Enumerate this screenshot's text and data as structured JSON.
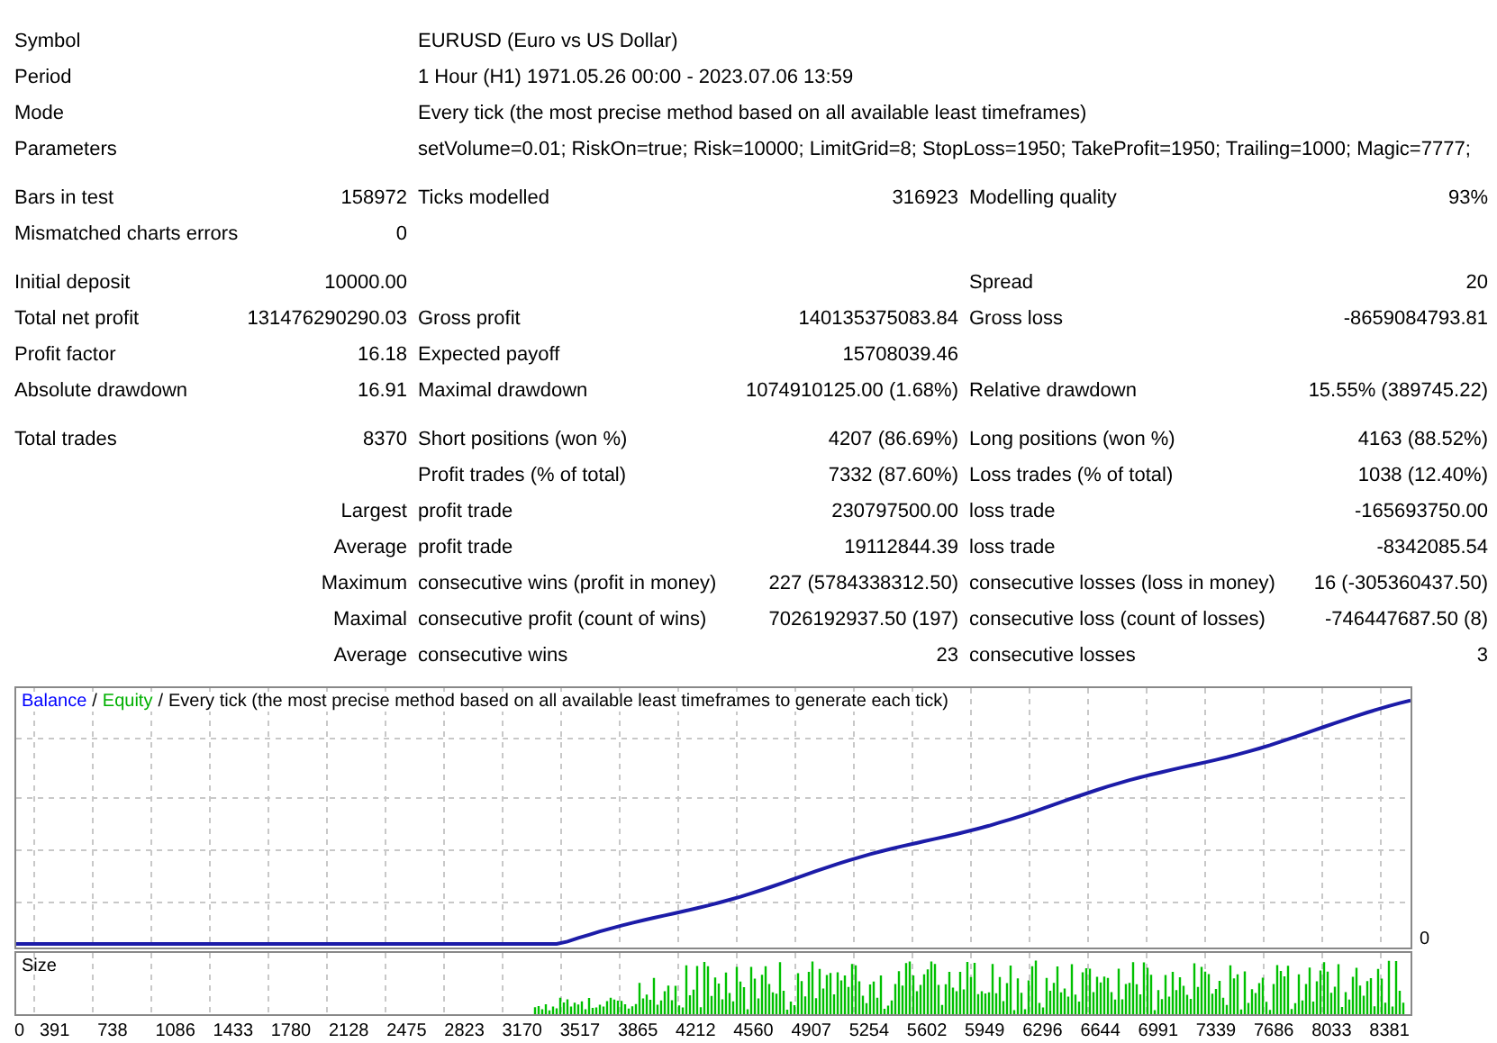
{
  "header": [
    {
      "label": "Symbol",
      "value": "EURUSD (Euro vs US Dollar)"
    },
    {
      "label": "Period",
      "value": "1 Hour (H1) 1971.05.26 00:00 - 2023.07.06 13:59"
    },
    {
      "label": "Mode",
      "value": "Every tick (the most precise method based on all available least timeframes)"
    },
    {
      "label": "Parameters",
      "value": "setVolume=0.01; RiskOn=true; Risk=10000; LimitGrid=8; StopLoss=1950; TakeProfit=1950; Trailing=1000; Magic=7777;"
    }
  ],
  "sections": [
    [
      {
        "cells": [
          {
            "label": "Bars in test",
            "value": "158972"
          },
          {
            "label": "Ticks modelled",
            "value": "316923"
          },
          {
            "label": "Modelling quality",
            "value": "93%"
          }
        ]
      },
      {
        "cells": [
          {
            "label": "Mismatched charts errors",
            "value": "0"
          }
        ]
      }
    ],
    [
      {
        "cells": [
          {
            "label": "Initial deposit",
            "value": "10000.00"
          },
          null,
          {
            "label": "Spread",
            "value": "20"
          }
        ]
      },
      {
        "cells": [
          {
            "label": "Total net profit",
            "value": "131476290290.03"
          },
          {
            "label": "Gross profit",
            "value": "140135375083.84"
          },
          {
            "label": "Gross loss",
            "value": "-8659084793.81"
          }
        ]
      },
      {
        "cells": [
          {
            "label": "Profit factor",
            "value": "16.18"
          },
          {
            "label": "Expected payoff",
            "value": "15708039.46"
          }
        ]
      },
      {
        "cells": [
          {
            "label": "Absolute drawdown",
            "value": "16.91"
          },
          {
            "label": "Maximal drawdown",
            "value": "1074910125.00 (1.68%)"
          },
          {
            "label": "Relative drawdown",
            "value": "15.55% (389745.22)"
          }
        ]
      }
    ],
    [
      {
        "cells": [
          {
            "label": "Total trades",
            "value": "8370"
          },
          {
            "label": "Short positions (won %)",
            "value": "4207 (86.69%)"
          },
          {
            "label": "Long positions (won %)",
            "value": "4163 (88.52%)"
          }
        ]
      },
      {
        "cells": [
          null,
          {
            "label": "Profit trades (% of total)",
            "value": "7332 (87.60%)"
          },
          {
            "label": "Loss trades (% of total)",
            "value": "1038 (12.40%)"
          }
        ]
      },
      {
        "prefix": "Largest",
        "cells": [
          null,
          {
            "label": "profit trade",
            "value": "230797500.00"
          },
          {
            "label": "loss trade",
            "value": "-165693750.00"
          }
        ]
      },
      {
        "prefix": "Average",
        "cells": [
          null,
          {
            "label": "profit trade",
            "value": "19112844.39"
          },
          {
            "label": "loss trade",
            "value": "-8342085.54"
          }
        ]
      },
      {
        "prefix": "Maximum",
        "cells": [
          null,
          {
            "label": "consecutive wins (profit in money)",
            "value": "227 (5784338312.50)"
          },
          {
            "label": "consecutive losses (loss in money)",
            "value": "16 (-305360437.50)"
          }
        ]
      },
      {
        "prefix": "Maximal",
        "cells": [
          null,
          {
            "label": "consecutive profit (count of wins)",
            "value": "7026192937.50 (197)"
          },
          {
            "label": "consecutive loss (count of losses)",
            "value": "-746447687.50 (8)"
          }
        ]
      },
      {
        "prefix": "Average",
        "cells": [
          null,
          {
            "label": "consecutive wins",
            "value": "23"
          },
          {
            "label": "consecutive losses",
            "value": "3"
          }
        ]
      }
    ]
  ],
  "chart": {
    "legend": [
      {
        "label": "Balance",
        "color": "#0000ff"
      },
      {
        "label": "Equity",
        "color": "#00b000"
      },
      {
        "label": "Every tick (the most precise method based on all available least timeframes to generate each tick)",
        "color": "#000000"
      }
    ],
    "separator": "/",
    "axis_label": "0",
    "size_label": "Size",
    "x_labels": [
      "0",
      "391",
      "738",
      "1086",
      "1433",
      "1780",
      "2128",
      "2475",
      "2823",
      "3170",
      "3517",
      "3865",
      "4212",
      "4560",
      "4907",
      "5254",
      "5602",
      "5949",
      "6296",
      "6644",
      "6991",
      "7339",
      "7686",
      "8033",
      "8381"
    ]
  }
}
